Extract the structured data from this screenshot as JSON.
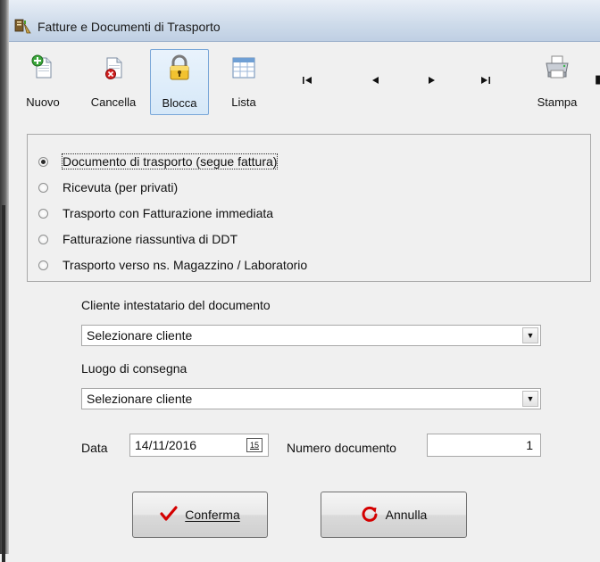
{
  "window": {
    "title": "Fatture e Documenti di Trasporto",
    "title_icon": "documents-icon"
  },
  "toolbar": {
    "buttons": [
      {
        "label": "Nuovo",
        "icon": "new-document-icon"
      },
      {
        "label": "Cancella",
        "icon": "delete-document-icon"
      },
      {
        "label": "Blocca",
        "icon": "lock-icon",
        "pressed": true
      },
      {
        "label": "Lista",
        "icon": "list-grid-icon"
      },
      {
        "label": "Stampa",
        "icon": "printer-icon"
      }
    ],
    "nav": {
      "first": "⏮ first-record-icon",
      "prev": "prev-record-icon",
      "next": "next-record-icon",
      "last": "last-record-icon"
    }
  },
  "document_type": {
    "options": [
      {
        "label": "Documento di trasporto (segue fattura)",
        "selected": true
      },
      {
        "label": "Ricevuta (per privati)",
        "selected": false
      },
      {
        "label": "Trasporto con Fatturazione immediata",
        "selected": false
      },
      {
        "label": "Fatturazione riassuntiva di DDT",
        "selected": false
      },
      {
        "label": "Trasporto verso ns. Magazzino / Laboratorio",
        "selected": false
      }
    ]
  },
  "cliente": {
    "label": "Cliente intestatario del documento",
    "value": "Selezionare cliente"
  },
  "consegna": {
    "label": "Luogo di consegna",
    "value": "Selezionare cliente"
  },
  "data": {
    "label": "Data",
    "value": "14/11/2016",
    "calendar_glyph": "15"
  },
  "numero": {
    "label": "Numero documento",
    "value": "1"
  },
  "actions": {
    "confirm_label": "Conferma",
    "cancel_label": "Annulla"
  },
  "colors": {
    "confirm_check": "#d40000",
    "cancel_refresh": "#d40000",
    "selection_blue": "#7aa7d8"
  }
}
